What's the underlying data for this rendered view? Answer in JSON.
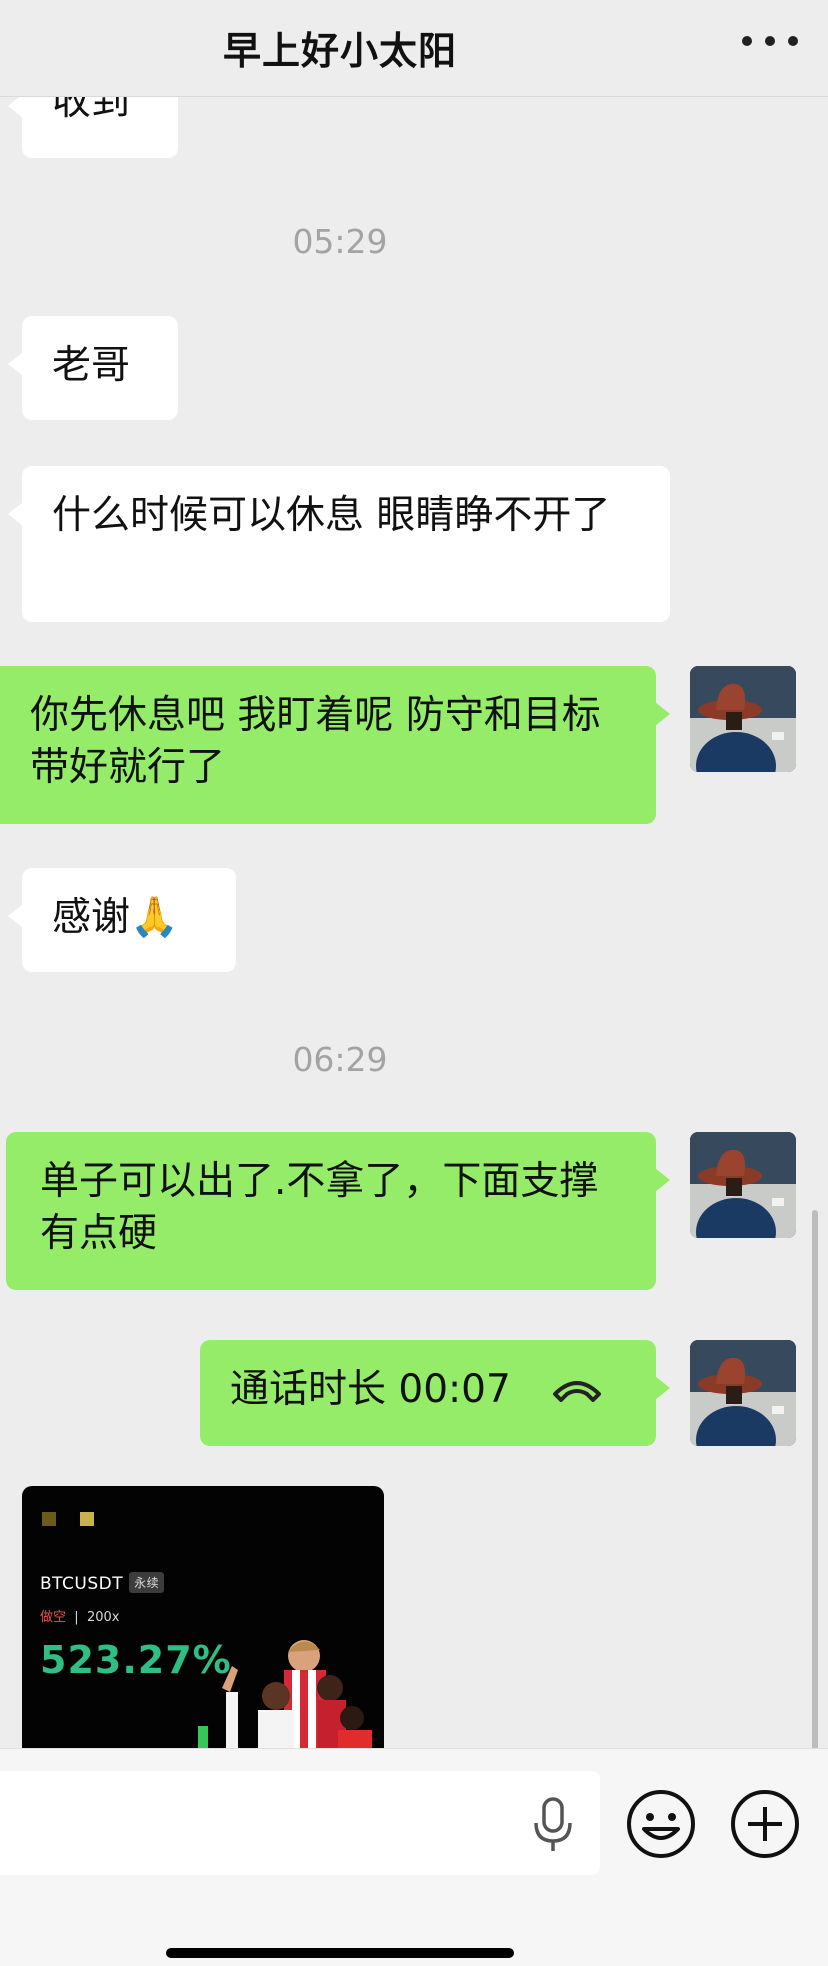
{
  "header": {
    "title": "早上好小太阳"
  },
  "messages": {
    "m0": "收到",
    "t1": "05:29",
    "m1": "老哥",
    "m2": "什么时候可以休息 眼睛睁不开了",
    "m3": "你先休息吧 我盯着呢 防守和目标带好就行了",
    "m4": "感谢🙏",
    "t2": "06:29",
    "m5": "单子可以出了.不拿了，下面支撑有点硬",
    "m6": "通话时长 00:07"
  },
  "image_card": {
    "pair": "BTCUSDT",
    "tag": "永续",
    "side": "做空",
    "leverage": "200x",
    "pnl": "523.27%"
  },
  "colors": {
    "outgoing_bubble": "#95ec69",
    "incoming_bubble": "#ffffff",
    "background": "#ededed",
    "pnl_green": "#2fbe84"
  },
  "icons": {
    "more": "more-dots-icon",
    "call": "phone-handset-icon",
    "mic": "microphone-icon",
    "emoji": "emoji-smile-icon",
    "plus": "plus-circle-icon"
  }
}
